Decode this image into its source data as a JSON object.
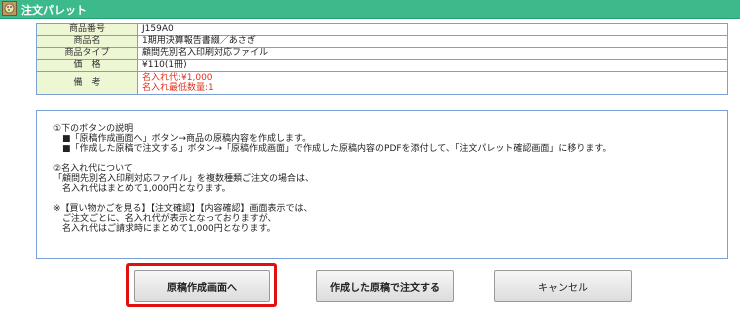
{
  "window": {
    "title": "注文パレット"
  },
  "info": {
    "rows": [
      {
        "label": "商品番号",
        "value": "J159A0"
      },
      {
        "label": "商品名",
        "value": "1期用決算報告書綴／あさぎ"
      },
      {
        "label": "商品タイプ",
        "value": "顧問先別名入印刷対応ファイル"
      },
      {
        "label": "価　格",
        "value": "¥110(1冊)"
      }
    ],
    "note": {
      "label": "備　考",
      "line1": "名入れ代:¥1,000",
      "line2": "名入れ最低数量:1"
    }
  },
  "explain": {
    "l1": "①下のボタンの説明",
    "l2": "　■「原稿作成画面へ」ボタン→商品の原稿内容を作成します。",
    "l3": "　■「作成した原稿で注文する」ボタン→「原稿作成画面」で作成した原稿内容のPDFを添付して、「注文パレット確認画面」に移ります。",
    "l4": "②名入れ代について",
    "l5": "「顧問先別名入印刷対応ファイル」を複数種類ご注文の場合は、",
    "l6": "　名入れ代はまとめて1,000円となります。",
    "l7": "※【買い物かごを見る】【注文確認】【内容確認】画面表示では、",
    "l8": "　ご注文ごとに、名入れ代が表示となっておりますが、",
    "l9": "　名入れ代はご請求時にまとめて1,000円となります。"
  },
  "buttons": {
    "create": "原稿作成画面へ",
    "order": "作成した原稿で注文する",
    "cancel": "キャンセル"
  },
  "colors": {
    "titlebar": "#3cba8c",
    "label_bg": "#eef7d4",
    "border": "#7aa0d6",
    "note_text": "#e0301e",
    "highlight": "#e01010"
  }
}
